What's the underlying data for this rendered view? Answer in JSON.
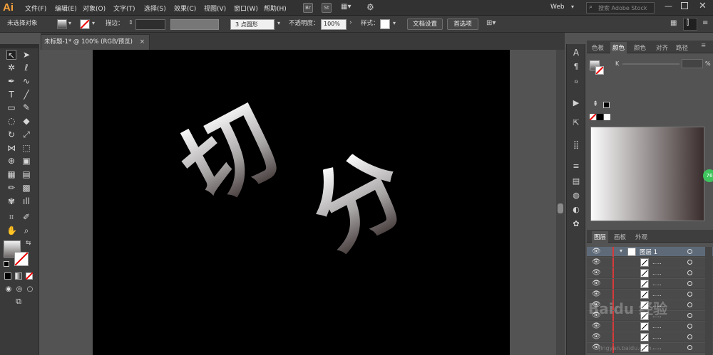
{
  "app": {
    "logo": "Ai"
  },
  "menu": {
    "items": [
      "文件(F)",
      "编辑(E)",
      "对象(O)",
      "文字(T)",
      "选择(S)",
      "效果(C)",
      "视图(V)",
      "窗口(W)",
      "帮助(H)"
    ],
    "bridge": "Br",
    "stock": "St",
    "workspace": "Web",
    "search_placeholder": "搜索 Adobe Stock"
  },
  "control_bar": {
    "selection_status": "未选择对象",
    "stroke_label": "描边：",
    "brush_value": "3 点圆形",
    "opacity_label": "不透明度：",
    "opacity_value": "100%",
    "style_label": "样式：",
    "doc_setup_button": "文档设置",
    "preferences_button": "首选项"
  },
  "document": {
    "tab_title": "未标题-1* @ 100% (RGB/预览)",
    "close_glyph": "×"
  },
  "artwork": {
    "glyphs": [
      "切",
      "分"
    ]
  },
  "color_panel": {
    "tabs": [
      "色板",
      "颜色",
      "颜色",
      "对齐",
      "路径"
    ],
    "active_tab": "颜色",
    "channel_label": "K",
    "percent_sign": "%",
    "badge_value": "76",
    "gradient_colors": [
      "#fbfbfb",
      "#3a2d2d"
    ]
  },
  "layers_panel": {
    "tabs": [
      "图层",
      "画板",
      "外观"
    ],
    "top_layer_name": "图层 1",
    "row_label": ".....",
    "row_count": 9
  },
  "watermark": {
    "text": "Baidu 经验",
    "host": "jingyan.baidu.com"
  }
}
